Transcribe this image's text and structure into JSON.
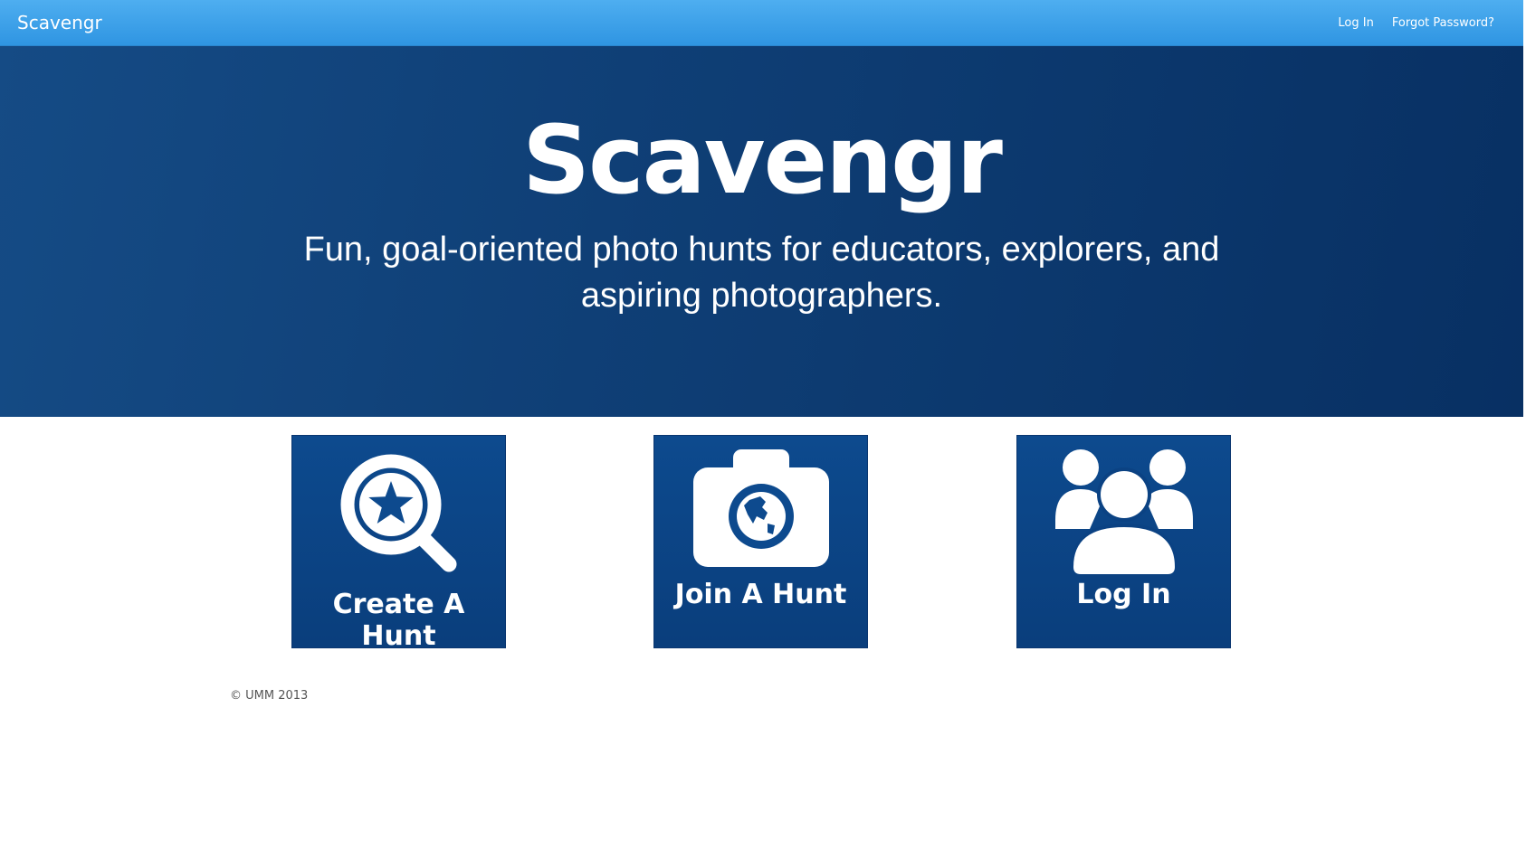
{
  "navbar": {
    "brand": "Scavengr",
    "links": [
      {
        "label": "Log In"
      },
      {
        "label": "Forgot Password?"
      }
    ]
  },
  "hero": {
    "title": "Scavengr",
    "subtitle": "Fun, goal-oriented photo hunts for educators, explorers, and aspiring photographers."
  },
  "tiles": [
    {
      "label": "Create A Hunt",
      "icon": "magnifier-star-icon"
    },
    {
      "label": "Join A Hunt",
      "icon": "camera-globe-icon"
    },
    {
      "label": "Log In",
      "icon": "users-group-icon"
    }
  ],
  "footer": {
    "copyright": "© UMM 2013"
  },
  "colors": {
    "navbar": "#3ba3ea",
    "hero": "#0f3f76",
    "tile": "#0b4283",
    "text_on_dark": "#ffffff"
  }
}
